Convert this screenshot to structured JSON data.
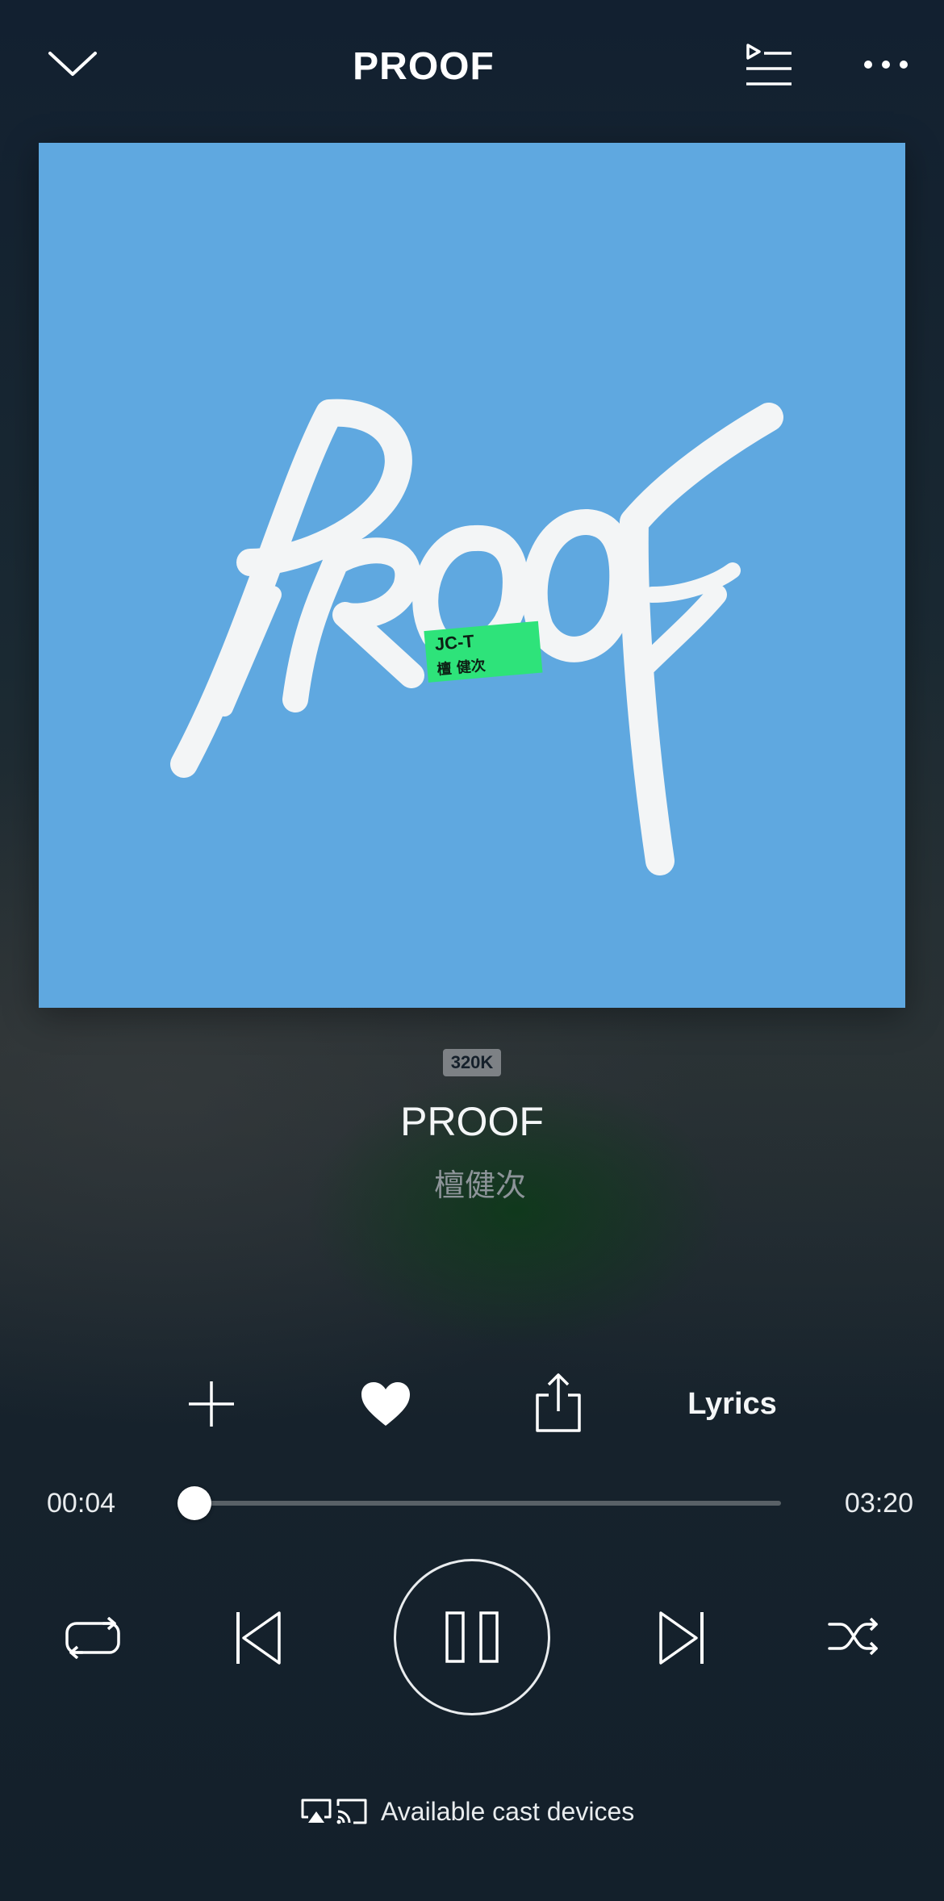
{
  "header": {
    "title": "PROOF",
    "collapse_icon": "chevron-down-icon",
    "queue_icon": "queue-icon",
    "more_icon": "more-horizontal-icon"
  },
  "album_art": {
    "text": "PROOF",
    "sticker_line1": "JC-T",
    "sticker_line2": "檀 健次",
    "background_color": "#5fa8e0",
    "sticker_color": "#2ee37a"
  },
  "track": {
    "quality": "320K",
    "title": "PROOF",
    "artist": "檀健次"
  },
  "actions": {
    "add_icon": "plus-icon",
    "like_icon": "heart-icon",
    "share_icon": "share-icon",
    "lyrics_label": "Lyrics"
  },
  "progress": {
    "elapsed": "00:04",
    "duration": "03:20",
    "fraction": 0.02
  },
  "transport": {
    "repeat_icon": "repeat-icon",
    "previous_icon": "skip-previous-icon",
    "play_state_icon": "pause-icon",
    "next_icon": "skip-next-icon",
    "shuffle_icon": "shuffle-icon"
  },
  "cast": {
    "label": "Available cast devices",
    "airplay_icon": "airplay-icon",
    "cast_icon": "cast-icon"
  }
}
